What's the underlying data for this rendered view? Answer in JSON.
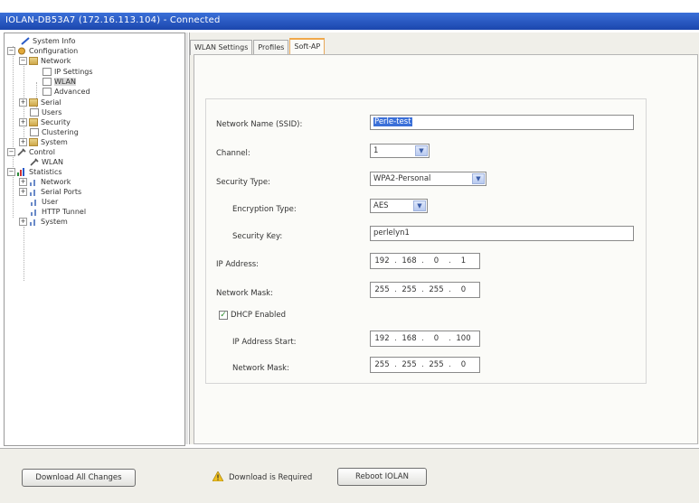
{
  "window": {
    "title": "IOLAN-DB53A7 (172.16.113.104) - Connected"
  },
  "tree": {
    "system_info": "System Info",
    "configuration": "Configuration",
    "network": "Network",
    "ip_settings": "IP Settings",
    "wlan": "WLAN",
    "advanced": "Advanced",
    "serial": "Serial",
    "users": "Users",
    "security": "Security",
    "clustering": "Clustering",
    "system": "System",
    "control": "Control",
    "control_wlan": "WLAN",
    "statistics": "Statistics",
    "stat_network": "Network",
    "stat_serial_ports": "Serial Ports",
    "stat_user": "User",
    "stat_http_tunnel": "HTTP Tunnel",
    "stat_system": "System"
  },
  "tabs": {
    "wlan_settings": "WLAN Settings",
    "profiles": "Profiles",
    "soft_ap": "Soft-AP"
  },
  "form": {
    "ssid_label": "Network Name (SSID):",
    "ssid_value": "Perle-test",
    "channel_label": "Channel:",
    "channel_value": "1",
    "security_type_label": "Security Type:",
    "security_type_value": "WPA2-Personal",
    "encryption_type_label": "Encryption Type:",
    "encryption_type_value": "AES",
    "security_key_label": "Security Key:",
    "security_key_value": "perlelyn1",
    "ip_address_label": "IP Address:",
    "ip_address": [
      "192",
      "168",
      "0",
      "1"
    ],
    "network_mask_label": "Network Mask:",
    "network_mask": [
      "255",
      "255",
      "255",
      "0"
    ],
    "dhcp_enabled_label": "DHCP Enabled",
    "dhcp_enabled": true,
    "ip_start_label": "IP Address Start:",
    "ip_start": [
      "192",
      "168",
      "0",
      "100"
    ],
    "dhcp_mask_label": "Network Mask:",
    "dhcp_mask": [
      "255",
      "255",
      "255",
      "0"
    ]
  },
  "bottom": {
    "download_button": "Download All Changes",
    "status_text": "Download is Required",
    "reboot_button": "Reboot IOLAN"
  }
}
